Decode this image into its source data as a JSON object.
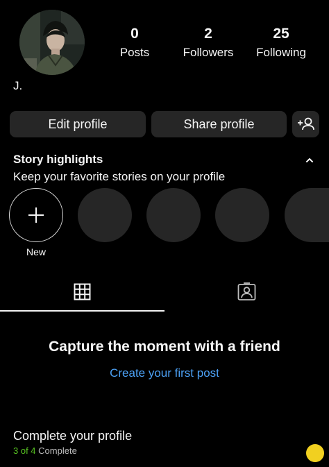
{
  "profile": {
    "username": "J."
  },
  "stats": [
    {
      "value": "0",
      "label": "Posts"
    },
    {
      "value": "2",
      "label": "Followers"
    },
    {
      "value": "25",
      "label": "Following"
    }
  ],
  "buttons": {
    "edit_profile": "Edit profile",
    "share_profile": "Share profile"
  },
  "highlights": {
    "title": "Story highlights",
    "subtitle": "Keep your favorite stories on your profile",
    "new_label": "New"
  },
  "tabs": [
    "grid",
    "tagged"
  ],
  "empty_state": {
    "title": "Capture the moment with a friend",
    "link": "Create your first post"
  },
  "complete_profile": {
    "title": "Complete your profile",
    "progress_text": "3 of 4",
    "suffix": "Complete",
    "progress": 0.75
  },
  "colors": {
    "background": "#000000",
    "button": "#262626",
    "link": "#4ca1f5",
    "progress": "#58c322"
  }
}
